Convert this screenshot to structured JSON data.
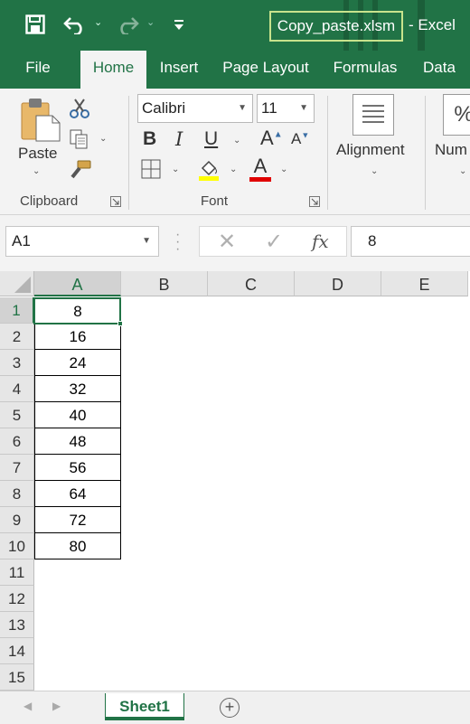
{
  "titlebar": {
    "filename": "Copy_paste.xlsm",
    "app_name": "- Excel",
    "colors": {
      "brand": "#217346",
      "filename_border": "#c8e38c"
    }
  },
  "ribbon_tabs": [
    {
      "label": "File"
    },
    {
      "label": "Home",
      "active": true
    },
    {
      "label": "Insert"
    },
    {
      "label": "Page Layout"
    },
    {
      "label": "Formulas"
    },
    {
      "label": "Data"
    }
  ],
  "clipboard": {
    "paste_label": "Paste",
    "group_label": "Clipboard"
  },
  "font": {
    "font_name": "Calibri",
    "font_size": "11",
    "group_label": "Font",
    "bold_label": "B",
    "italic_label": "I",
    "underline_label": "U",
    "grow_label": "A",
    "shrink_label": "A",
    "font_color_label": "A",
    "highlight_color": "#ffff00",
    "font_color": "#e00000"
  },
  "alignment": {
    "label": "Alignment"
  },
  "number": {
    "label": "Num",
    "icon_label": "%"
  },
  "formula_bar": {
    "name_box": "A1",
    "fx_label": "fx",
    "value": "8"
  },
  "grid": {
    "columns": [
      "A",
      "B",
      "C",
      "D",
      "E"
    ],
    "rows": [
      "1",
      "2",
      "3",
      "4",
      "5",
      "6",
      "7",
      "8",
      "9",
      "10",
      "11",
      "12",
      "13",
      "14",
      "15"
    ],
    "column_a_values": [
      "8",
      "16",
      "24",
      "32",
      "40",
      "48",
      "56",
      "64",
      "72",
      "80"
    ],
    "selected_cell": "A1"
  },
  "sheets": {
    "tabs": [
      "Sheet1"
    ],
    "active": "Sheet1",
    "add_label": "+"
  }
}
